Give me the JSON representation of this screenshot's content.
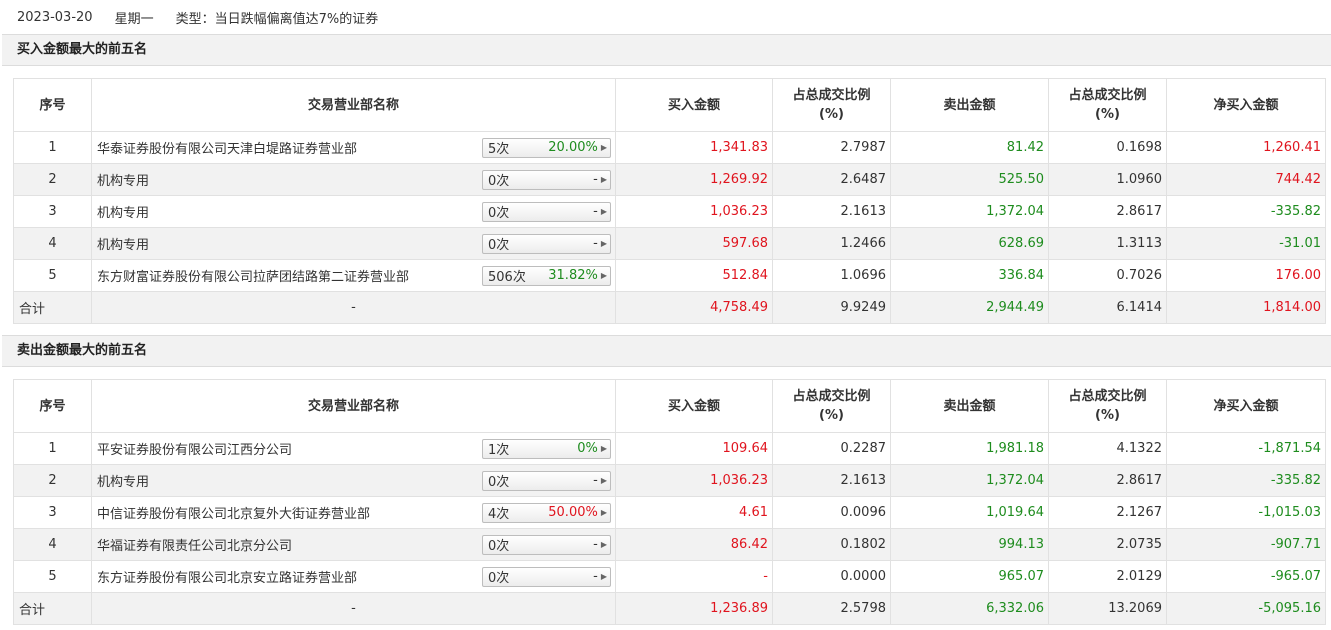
{
  "header": {
    "date": "2023-03-20",
    "weekday": "星期一",
    "type_label": "类型：当日跌幅偏离值达7%的证券"
  },
  "columns": {
    "seq": "序号",
    "dept": "交易营业部名称",
    "buy": "买入金额",
    "buy_pct": "占总成交比例",
    "pct_unit": "(%)",
    "sell": "卖出金额",
    "sell_pct": "占总成交比例",
    "net": "净买入金额"
  },
  "buy_section": {
    "title": "买入金额最大的前五名",
    "rows": [
      {
        "seq": "1",
        "name": "华泰证券股份有限公司天津白堤路证券营业部",
        "count": "5次",
        "pct": "20.00%",
        "pct_color": "green",
        "buy": "1,341.83",
        "buy_pct": "2.7987",
        "sell": "81.42",
        "sell_pct": "0.1698",
        "net": "1,260.41",
        "net_color": "red"
      },
      {
        "seq": "2",
        "name": "机构专用",
        "count": "0次",
        "pct": "-",
        "pct_color": "plain",
        "buy": "1,269.92",
        "buy_pct": "2.6487",
        "sell": "525.50",
        "sell_pct": "1.0960",
        "net": "744.42",
        "net_color": "red"
      },
      {
        "seq": "3",
        "name": "机构专用",
        "count": "0次",
        "pct": "-",
        "pct_color": "plain",
        "buy": "1,036.23",
        "buy_pct": "2.1613",
        "sell": "1,372.04",
        "sell_pct": "2.8617",
        "net": "-335.82",
        "net_color": "green"
      },
      {
        "seq": "4",
        "name": "机构专用",
        "count": "0次",
        "pct": "-",
        "pct_color": "plain",
        "buy": "597.68",
        "buy_pct": "1.2466",
        "sell": "628.69",
        "sell_pct": "1.3113",
        "net": "-31.01",
        "net_color": "green"
      },
      {
        "seq": "5",
        "name": "东方财富证券股份有限公司拉萨团结路第二证券营业部",
        "count": "506次",
        "pct": "31.82%",
        "pct_color": "green",
        "buy": "512.84",
        "buy_pct": "1.0696",
        "sell": "336.84",
        "sell_pct": "0.7026",
        "net": "176.00",
        "net_color": "red"
      }
    ],
    "total": {
      "label": "合计",
      "name": "-",
      "buy": "4,758.49",
      "buy_pct": "9.9249",
      "sell": "2,944.49",
      "sell_pct": "6.1414",
      "net": "1,814.00",
      "net_color": "red"
    }
  },
  "sell_section": {
    "title": "卖出金额最大的前五名",
    "rows": [
      {
        "seq": "1",
        "name": "平安证券股份有限公司江西分公司",
        "count": "1次",
        "pct": "0%",
        "pct_color": "green",
        "buy": "109.64",
        "buy_pct": "0.2287",
        "sell": "1,981.18",
        "sell_pct": "4.1322",
        "net": "-1,871.54",
        "net_color": "green"
      },
      {
        "seq": "2",
        "name": "机构专用",
        "count": "0次",
        "pct": "-",
        "pct_color": "plain",
        "buy": "1,036.23",
        "buy_pct": "2.1613",
        "sell": "1,372.04",
        "sell_pct": "2.8617",
        "net": "-335.82",
        "net_color": "green"
      },
      {
        "seq": "3",
        "name": "中信证券股份有限公司北京复外大街证券营业部",
        "count": "4次",
        "pct": "50.00%",
        "pct_color": "red",
        "buy": "4.61",
        "buy_pct": "0.0096",
        "sell": "1,019.64",
        "sell_pct": "2.1267",
        "net": "-1,015.03",
        "net_color": "green"
      },
      {
        "seq": "4",
        "name": "华福证券有限责任公司北京分公司",
        "count": "0次",
        "pct": "-",
        "pct_color": "plain",
        "buy": "86.42",
        "buy_pct": "0.1802",
        "sell": "994.13",
        "sell_pct": "2.0735",
        "net": "-907.71",
        "net_color": "green"
      },
      {
        "seq": "5",
        "name": "东方证券股份有限公司北京安立路证券营业部",
        "count": "0次",
        "pct": "-",
        "pct_color": "plain",
        "buy": "-",
        "buy_pct": "0.0000",
        "sell": "965.07",
        "sell_pct": "2.0129",
        "net": "-965.07",
        "net_color": "green"
      }
    ],
    "total": {
      "label": "合计",
      "name": "-",
      "buy": "1,236.89",
      "buy_pct": "2.5798",
      "sell": "6,332.06",
      "sell_pct": "13.2069",
      "net": "-5,095.16",
      "net_color": "green"
    }
  },
  "colors": {
    "red": "#e0141e",
    "green": "#1e8c1e",
    "header_bg": "#f2f2f2",
    "row_alt_bg": "#f2f2f2"
  },
  "icons": {
    "pill_arrow": "caret-right-icon"
  }
}
